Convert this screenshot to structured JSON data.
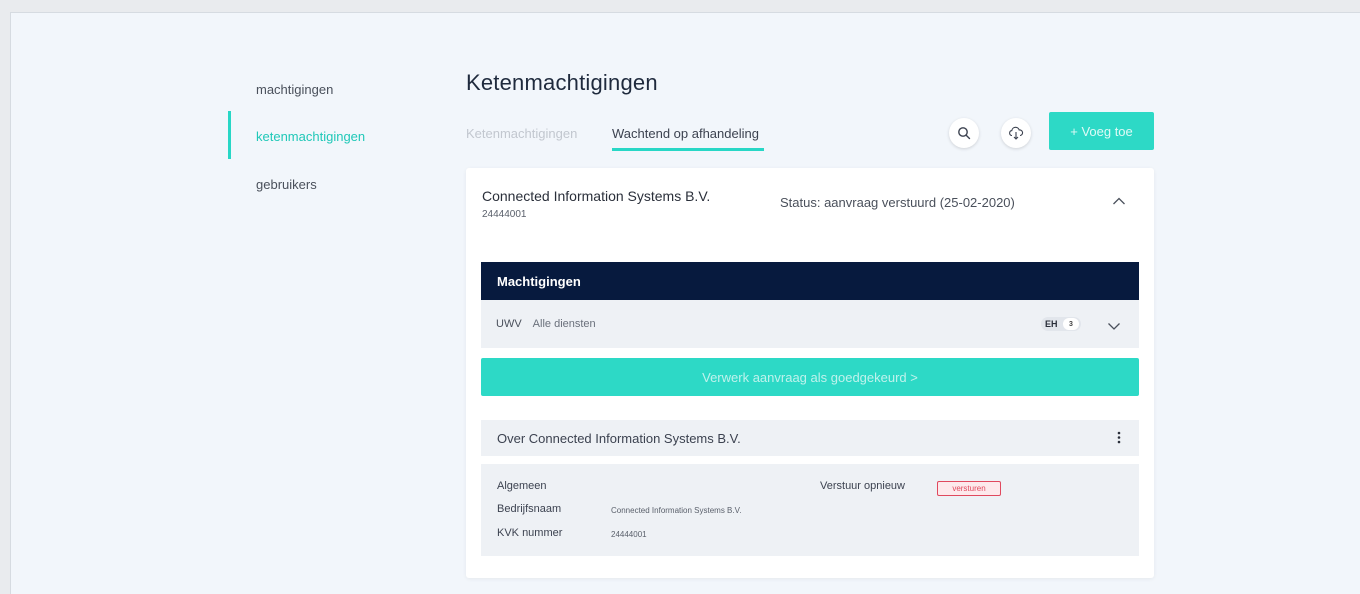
{
  "sidebar": {
    "items": [
      {
        "label": "machtigingen",
        "active": false
      },
      {
        "label": "ketenmachtigingen",
        "active": true
      },
      {
        "label": "gebruikers",
        "active": false
      }
    ]
  },
  "page": {
    "title": "Ketenmachtigingen",
    "tabs": [
      {
        "label": "Ketenmachtigingen",
        "active": false
      },
      {
        "label": "Wachtend op afhandeling",
        "active": true
      }
    ],
    "add_button": "+  Voeg toe"
  },
  "card": {
    "company_name": "Connected Information Systems B.V.",
    "company_id": "24444001",
    "status": "Status: aanvraag verstuurd (25-02-2020)",
    "machtigingen_header": "Machtigingen",
    "row": {
      "code": "UWV",
      "service": "Alle diensten",
      "toggle_label": "EH",
      "toggle_count": "3"
    },
    "approve_button": "Verwerk aanvraag als goedgekeurd  >",
    "about_title": "Over Connected Information Systems B.V.",
    "info": {
      "section": "Algemeen",
      "name_label": "Bedrijfsnaam",
      "name_value": "Connected Information Systems B.V.",
      "kvk_label": "KVK nummer",
      "kvk_value": "24444001",
      "resend_label": "Verstuur opnieuw",
      "resend_button": "versturen"
    }
  },
  "colors": {
    "accent": "#2dd9c6",
    "navy": "#071a3e",
    "danger": "#e0495e"
  }
}
